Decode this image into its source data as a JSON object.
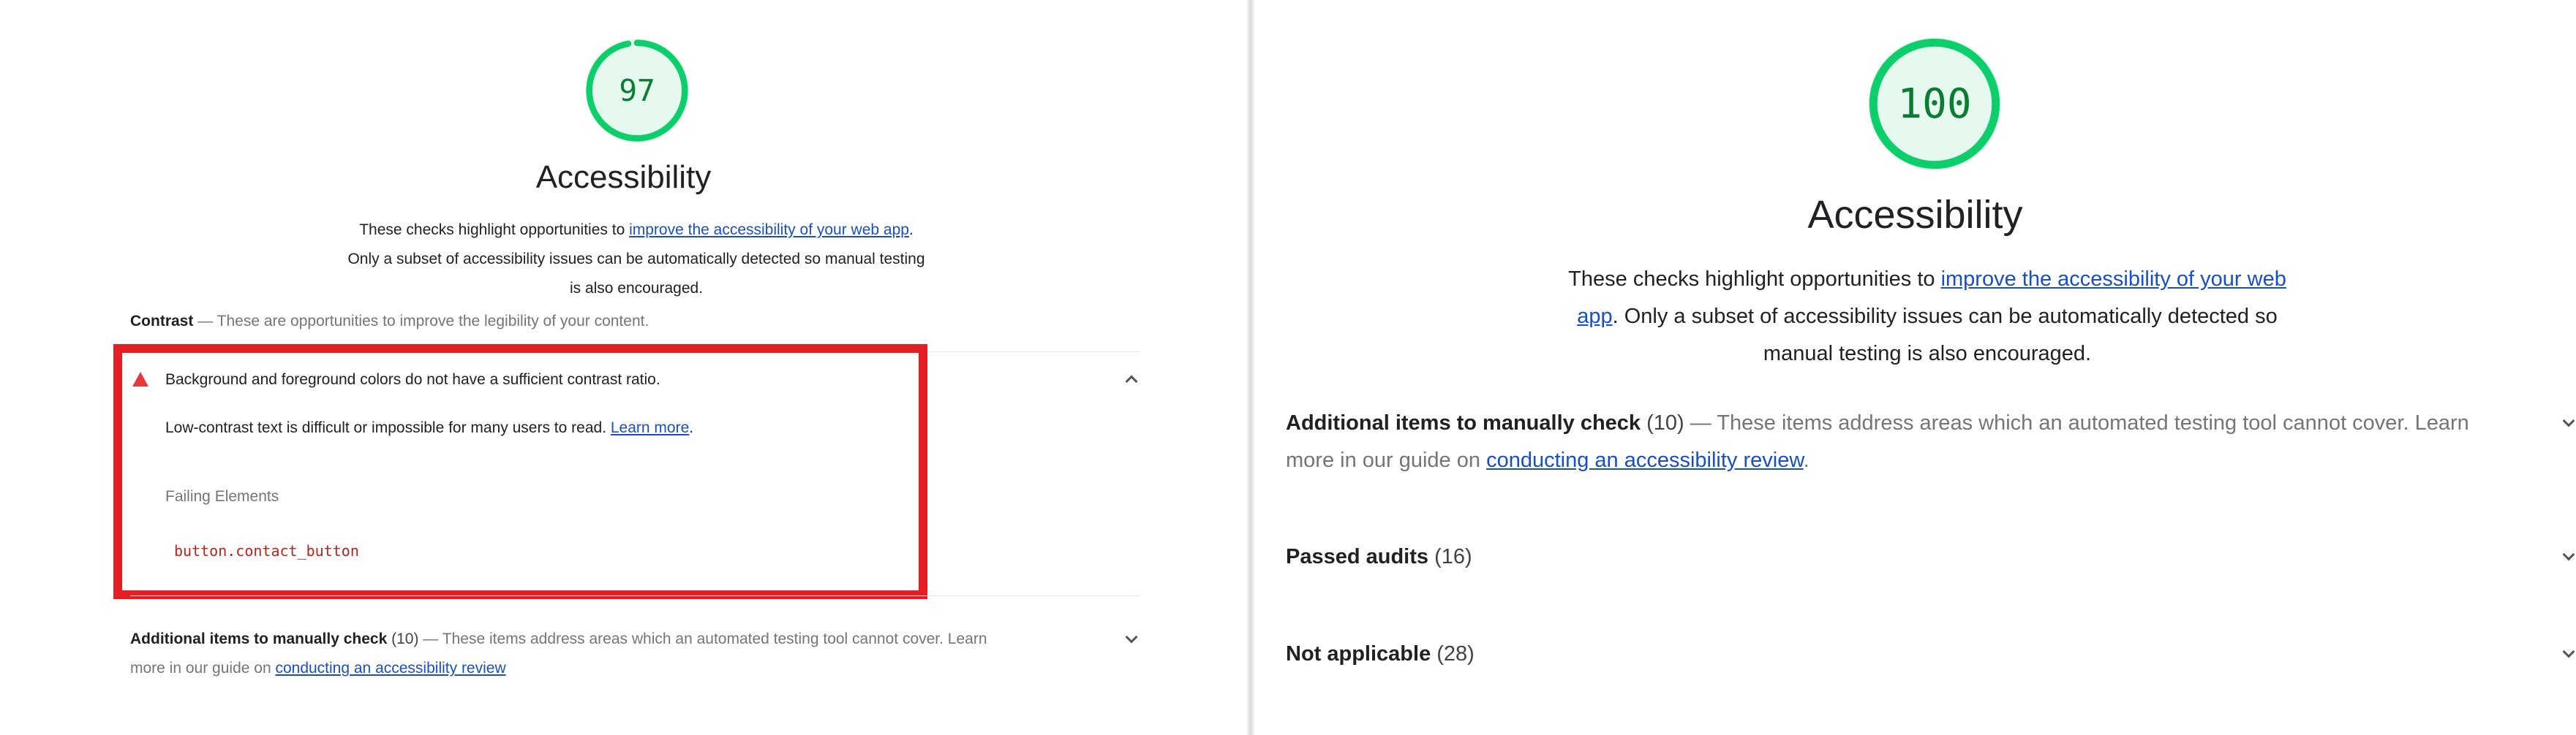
{
  "left": {
    "score": "97",
    "score_fraction": 0.97,
    "title": "Accessibility",
    "desc_prefix": "These checks highlight opportunities to ",
    "desc_link": "improve the accessibility of your web app",
    "desc_suffix": ". Only a subset of accessibility issues can be automatically detected so manual testing is also encouraged.",
    "contrast_group": {
      "title": "Contrast",
      "description": "— These are opportunities to improve the legibility of your content."
    },
    "audit": {
      "title": "Background and foreground colors do not have a sufficient contrast ratio.",
      "body": "Low-contrast text is difficult or impossible for many users to read.",
      "learn_more": "Learn more",
      "period": ".",
      "failing_label": "Failing Elements",
      "failing_element": "button.contact_button"
    },
    "manual": {
      "title": "Additional items to manually check",
      "count": "(10)",
      "desc": "— These items address areas which an automated testing tool cannot cover. Learn",
      "desc_line2": "more in our guide on ",
      "link": "conducting an accessibility review"
    }
  },
  "right": {
    "score": "100",
    "score_fraction": 1.0,
    "title": "Accessibility",
    "desc_prefix": "These checks highlight opportunities to ",
    "desc_link": "improve the accessibility of your web app",
    "desc_suffix": ". Only a subset of accessibility issues can be automatically detected so manual testing is also encouraged.",
    "manual": {
      "title": "Additional items to manually check",
      "count": "(10)",
      "desc": "— These items address areas which an automated testing tool cannot cover. Learn",
      "desc_line2": "more in our guide on ",
      "link": "conducting an accessibility review",
      "period": "."
    },
    "passed": {
      "title": "Passed audits",
      "count": "(16)"
    },
    "not_applicable": {
      "title": "Not applicable",
      "count": "(28)"
    }
  },
  "colors": {
    "pass_green": "#0cce6b",
    "pass_bg": "#e6f9ee",
    "fail_red": "#e8373a",
    "highlight_red": "#e31e24",
    "link_blue": "#1a4fc4"
  },
  "icons": [
    "warning-triangle-icon",
    "chevron-up-icon",
    "chevron-down-icon"
  ]
}
